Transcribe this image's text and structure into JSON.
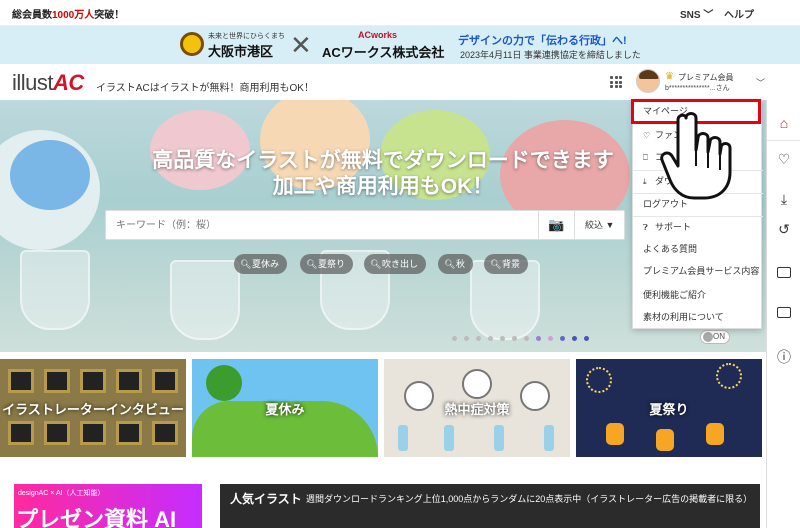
{
  "topbar": {
    "members_prefix": "総会員数",
    "members_count": "1000万人",
    "members_suffix": "突破！",
    "sns_label": "SNS",
    "help_label": "ヘルプ"
  },
  "announcement": {
    "minatoku_sub": "未来と世界にひらくまち",
    "minatoku": "大阪市港区",
    "acworks_logo": "ACworks",
    "acworks_name": "ACワークス株式会社",
    "headline": "デザインの力で「伝わる行政」へ!",
    "sub": "2023年4月11日 事業連携協定を締結しました"
  },
  "header": {
    "logo_text": "illust",
    "logo_accent": "AC",
    "tagline": "イラストACはイラストが無料！商用利用もOK！",
    "premium_label": "プレミアム会員",
    "username": "b***************...さん"
  },
  "hero": {
    "title_line1": "高品質なイラストが無料でダウンロードできます",
    "title_line2": "加工や商用利用もOK！",
    "search_placeholder": "キーワード（例：桜）",
    "filter_label": "絞込 ▼",
    "tags": [
      "夏休み",
      "夏祭り",
      "吹き出し",
      "秋",
      "背景"
    ],
    "toggle_label": "ON"
  },
  "tiles": [
    {
      "label": "イラストレーターインタビュー"
    },
    {
      "label": "夏休み"
    },
    {
      "label": "熱中症対策"
    },
    {
      "label": "夏祭り"
    }
  ],
  "bottom": {
    "banner_small": "designAC × AI（人工知能）",
    "banner_big": "プレゼン資料 AI",
    "popular_title": "人気イラスト",
    "popular_desc": "週間ダウンロードランキング上位1,000点からランダムに20点表示中（イラストレーター広告の掲載者に限る）"
  },
  "dropdown": {
    "items": [
      "マイページ",
      "ファン",
      "コ",
      "ダウ",
      "ログアウト",
      "サポート",
      "よくある質問",
      "プレミアム会員サービス内容",
      "便利機能ご紹介",
      "素材の利用について"
    ]
  },
  "colors": {
    "brand_red": "#d4142a",
    "highlight_red": "#e60012",
    "announce_bg": "#d8eef6",
    "headline_blue": "#1a57c9"
  },
  "icons": {
    "rail": [
      "home-icon",
      "heart-icon",
      "download-icon",
      "history-icon",
      "folder-icon",
      "folder-add-icon",
      "help-icon"
    ]
  }
}
